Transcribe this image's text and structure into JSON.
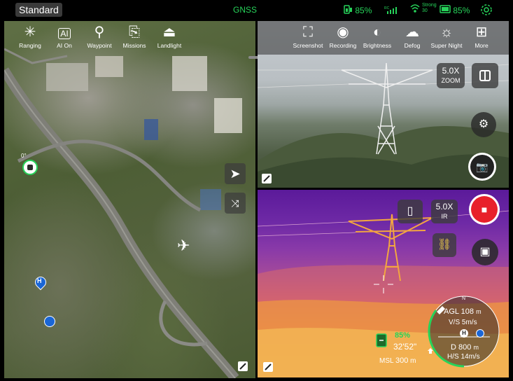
{
  "status": {
    "mode_label": "Standard",
    "gnss_label": "GNSS",
    "battery_rc": "85%",
    "signal_label": "Strong",
    "signal_value": "30",
    "battery_aircraft": "85%"
  },
  "map_tools": [
    {
      "label": "Ranging",
      "icon": "crosshair-icon"
    },
    {
      "label": "AI On",
      "icon": "ai-icon"
    },
    {
      "label": "Waypoint",
      "icon": "waypoint-icon"
    },
    {
      "label": "Missions",
      "icon": "missions-icon"
    },
    {
      "label": "Landlight",
      "icon": "landlight-icon"
    }
  ],
  "camera_tools": [
    {
      "label": "Screenshot",
      "icon": "screenshot-icon"
    },
    {
      "label": "Recording",
      "icon": "recording-icon"
    },
    {
      "label": "Brightness",
      "icon": "brightness-icon"
    },
    {
      "label": "Defog",
      "icon": "defog-icon"
    },
    {
      "label": "Super Night",
      "icon": "super-night-icon"
    },
    {
      "label": "More",
      "icon": "more-icon"
    }
  ],
  "map": {
    "heading_value": "0°",
    "home_marker": "H"
  },
  "wide_cam": {
    "zoom_value": "5.0X",
    "zoom_label": "ZOOM"
  },
  "ir_cam": {
    "zoom_value": "5.0X",
    "zoom_label": "IR"
  },
  "telemetry": {
    "battery": "85%",
    "flight_time": "32'52\"",
    "msl_label": "MSL",
    "msl_value": "300",
    "msl_unit": "m",
    "agl_label": "AGL",
    "agl_value": "108",
    "agl_unit": "m",
    "vs_label": "V/S",
    "vs_value": "5m/s",
    "distance_label": "D",
    "distance_value": "800",
    "distance_unit": "m",
    "hs_label": "H/S",
    "hs_value": "14m/s",
    "north_label": "N",
    "home_marker": "H"
  },
  "colors": {
    "accent_green": "#27d35a",
    "record_red": "#e8202a"
  }
}
